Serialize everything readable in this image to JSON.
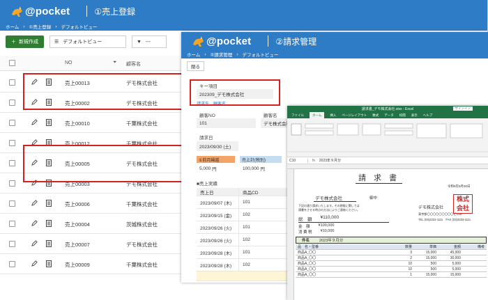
{
  "win1": {
    "brand": "@pocket",
    "title": "①売上登録",
    "breadcrumb": [
      "ホーム",
      "›",
      "①売上登録",
      "›",
      "デフォルトビュー"
    ],
    "new_button": "新規作成",
    "view_select": "デフォルトビュー",
    "filter_value": "---",
    "col_no": "NO",
    "col_name": "顧客名",
    "rows": [
      {
        "no": "売上00013",
        "name": "デモ株式会社"
      },
      {
        "no": "売上00002",
        "name": "デモ株式会社"
      },
      {
        "no": "売上00010",
        "name": "千葉株式会社"
      },
      {
        "no": "売上00012",
        "name": "千葉株式会社"
      },
      {
        "no": "売上00005",
        "name": "デモ株式会社"
      },
      {
        "no": "売上00003",
        "name": "デモ株式会社"
      },
      {
        "no": "売上00006",
        "name": "千葉株式会社"
      },
      {
        "no": "売上00004",
        "name": "茨城株式会社"
      },
      {
        "no": "売上00007",
        "name": "デモ株式会社"
      },
      {
        "no": "売上00009",
        "name": "千葉株式会社"
      }
    ],
    "accent": "#2f7cc6"
  },
  "win2": {
    "brand": "@pocket",
    "title": "②請求管理",
    "breadcrumb": [
      "ホーム",
      "›",
      "②請求管理",
      "›",
      "デフォルトビュー"
    ],
    "close_button": "閉る",
    "key_label": "キー項目",
    "key_value": "202309_デモ株式会社",
    "key_link": "請求先→顧客名",
    "customer_no_label": "顧客NO",
    "customer_no_value": "101",
    "customer_name_label": "顧客名",
    "customer_name_value": "デモ株式会社",
    "invoice_date_label": "請求日",
    "invoice_date_value": "2023/09/30 (土)",
    "prev_label": "①前月繰越",
    "prev_value": "5,000",
    "prev_unit": "円",
    "sales_label": "売上計(税別)",
    "sales_value": "100,000",
    "sales_unit": "円",
    "details_label": "■売上実績",
    "table_header": [
      "売上日",
      "商品CD"
    ],
    "table_rows": [
      [
        "2023/09/07 (木)",
        "101"
      ],
      [
        "2023/09/15 (金)",
        "102"
      ],
      [
        "2023/09/26 (火)",
        "101"
      ],
      [
        "2023/09/26 (火)",
        "102"
      ],
      [
        "2023/09/28 (木)",
        "101"
      ],
      [
        "2023/09/28 (木)",
        "102"
      ]
    ]
  },
  "win3": {
    "title": "請求書_デモ株式会社.xlsx - Excel",
    "signin": "サインイン",
    "tabs": [
      "ファイル",
      "ホーム",
      "挿入",
      "ページレイアウト",
      "数式",
      "データ",
      "校閲",
      "表示",
      "ヘルプ"
    ],
    "active_tab": "ホーム",
    "cell_ref": "C10",
    "formula": "2023年９月分",
    "invoice_title": "請 求 書",
    "invoice_date": "令和5年9月30日",
    "customer": "デモ株式会社",
    "honorific": "御中",
    "greeting_1": "下記の通り請求いたします。その期限に関しては",
    "greeting_2": "請書をさせる時点の方法によりご連絡ください。",
    "total_label": "総　額",
    "total_value": "¥110,000",
    "amount_label": "金　額",
    "amount_value": "¥100,000",
    "tax_label": "消 費 税",
    "tax_value": "¥10,000",
    "company": "デモ株式会社",
    "address": "東京都〇〇〇〇〇〇〇〇〇ビル6F",
    "tel": "TEL (03)2222-1111　FAX (03)3333-1111",
    "stamp_text": [
      "株式",
      "会社",
      "デモ"
    ],
    "period_label": "件名",
    "period_value": "2023年９月分",
    "item_header": [
      "品　名・型番",
      "",
      "数量",
      "単価",
      "金額",
      "備考"
    ],
    "items": [
      [
        "商品A_〇〇",
        "",
        "3",
        "15,000",
        "45,000",
        ""
      ],
      [
        "商品A_〇〇",
        "",
        "2",
        "15,000",
        "30,000",
        ""
      ],
      [
        "商品A_〇〇",
        "",
        "10",
        "500",
        "5,000",
        ""
      ],
      [
        "商品A_〇〇",
        "",
        "10",
        "500",
        "5,000",
        ""
      ],
      [
        "商品A_〇〇",
        "",
        "1",
        "15,000",
        "15,000",
        ""
      ]
    ]
  }
}
